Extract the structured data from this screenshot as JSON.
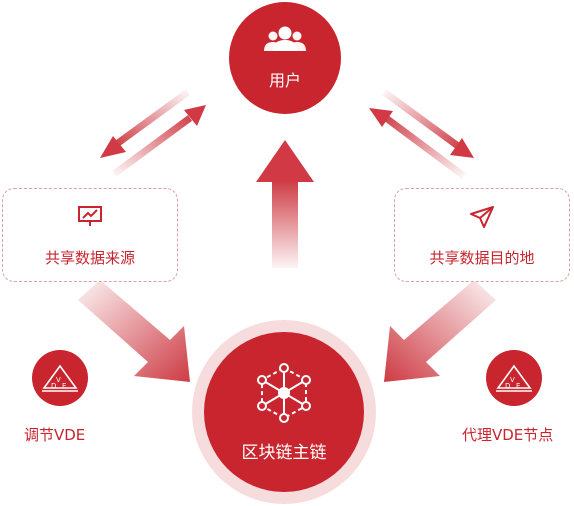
{
  "user_node": {
    "label": "用户",
    "icon": "users-icon"
  },
  "blockchain_node": {
    "label": "区块链主链",
    "icon": "network-hexagon-icon"
  },
  "source_box": {
    "label": "共享数据来源",
    "icon": "presentation-chart-icon"
  },
  "destination_box": {
    "label": "共享数据目的地",
    "icon": "paper-plane-icon"
  },
  "regulator_node": {
    "label": "调节VDE",
    "icon": "vde-badge-icon",
    "badge_text": [
      "V",
      "D",
      "E"
    ]
  },
  "proxy_node": {
    "label": "代理VDE节点",
    "icon": "vde-badge-icon",
    "badge_text": [
      "V",
      "D",
      "E"
    ]
  },
  "colors": {
    "primary": "#c8252f",
    "halo": "#f6dcdd",
    "box_border": "#d9a0a3",
    "white": "#ffffff"
  }
}
